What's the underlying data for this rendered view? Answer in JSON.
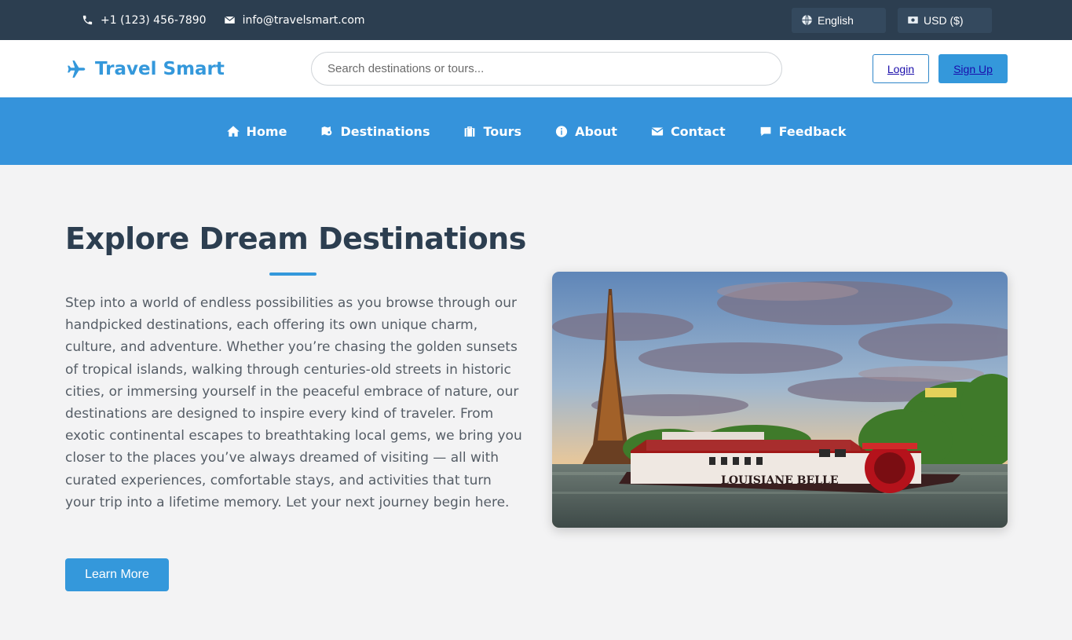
{
  "topbar": {
    "phone": "+1 (123) 456-7890",
    "email": "info@travelsmart.com",
    "language": "English",
    "currency": "USD ($)"
  },
  "header": {
    "brand": "Travel Smart",
    "search_placeholder": "Search destinations or tours...",
    "login_label": "Login",
    "signup_label": "Sign Up"
  },
  "nav": {
    "items": [
      {
        "label": "Home",
        "icon": "home-icon"
      },
      {
        "label": "Destinations",
        "icon": "map-marker-icon"
      },
      {
        "label": "Tours",
        "icon": "suitcase-icon"
      },
      {
        "label": "About",
        "icon": "info-icon"
      },
      {
        "label": "Contact",
        "icon": "envelope-icon"
      },
      {
        "label": "Feedback",
        "icon": "comment-icon"
      }
    ]
  },
  "hero": {
    "title": "Explore Dream Destinations",
    "description": "Step into a world of endless possibilities as you browse through our handpicked destinations, each offering its own unique charm, culture, and adventure. Whether you’re chasing the golden sunsets of tropical islands, walking through centuries-old streets in historic cities, or immersing yourself in the peaceful embrace of nature, our destinations are designed to inspire every kind of traveler. From exotic continental escapes to breathtaking local gems, we bring you closer to the places you’ve always dreamed of visiting — all with curated experiences, comfortable stays, and activities that turn your trip into a lifetime memory. Let your next journey begin here.",
    "button_label": "Learn More",
    "boat_name": "LOUISIANE BELLE"
  },
  "colors": {
    "topbar_bg": "#2c3e50",
    "accent": "#3498db",
    "nav_bg": "#3593db",
    "page_bg": "#f3f3f4"
  }
}
